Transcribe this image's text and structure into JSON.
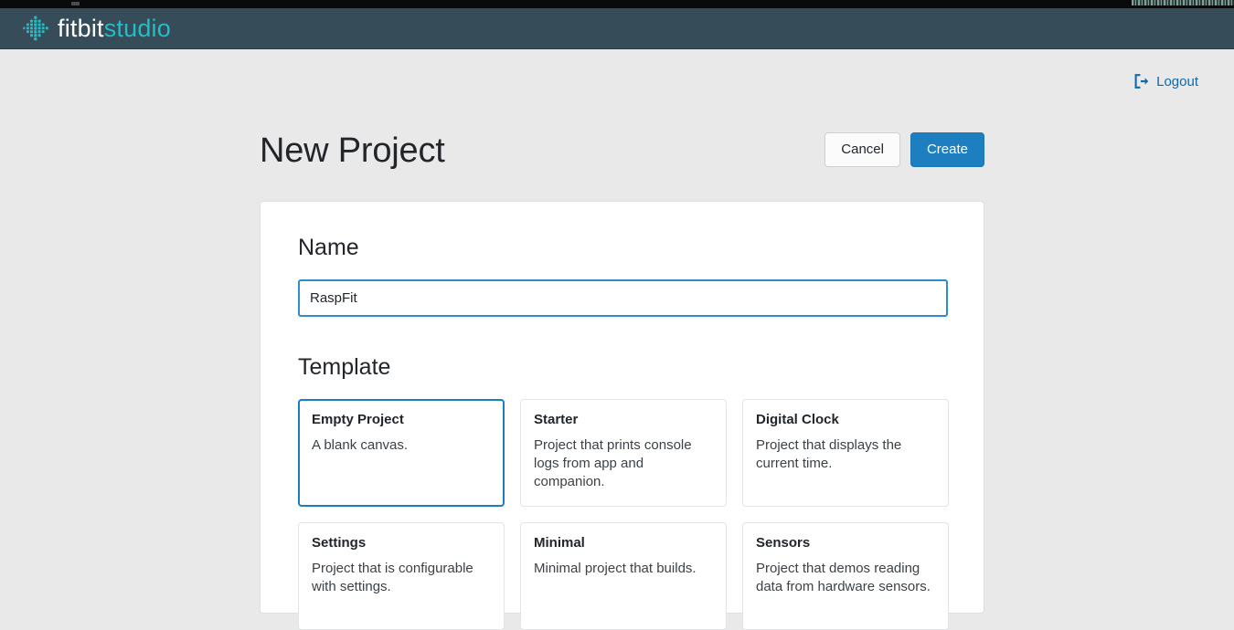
{
  "window": {
    "desktop_strip_color": "#0a0a0a"
  },
  "appbar": {
    "brand_primary": "fitbit",
    "brand_secondary": "studio",
    "logo_icon": "fitbit-dot-matrix-icon",
    "background_color": "#374c59",
    "brand_secondary_color": "#1fbfc9"
  },
  "account": {
    "logout_label": "Logout",
    "logout_icon": "sign-out-icon",
    "link_color": "#0d6aad"
  },
  "header": {
    "title": "New Project",
    "cancel_label": "Cancel",
    "create_label": "Create",
    "create_color": "#1d7fc0"
  },
  "form": {
    "name": {
      "label": "Name",
      "value": "RaspFit",
      "placeholder": "",
      "focus_color": "#2e8ccc"
    },
    "template": {
      "label": "Template",
      "selected_index": 0,
      "selected_color": "#1a7fbf",
      "options": [
        {
          "name": "Empty Project",
          "description": "A blank canvas."
        },
        {
          "name": "Starter",
          "description": "Project that prints console logs from app and companion."
        },
        {
          "name": "Digital Clock",
          "description": "Project that displays the current time."
        },
        {
          "name": "Settings",
          "description": "Project that is configurable with settings."
        },
        {
          "name": "Minimal",
          "description": "Minimal project that builds."
        },
        {
          "name": "Sensors",
          "description": "Project that demos reading data from hardware sensors."
        }
      ]
    }
  }
}
